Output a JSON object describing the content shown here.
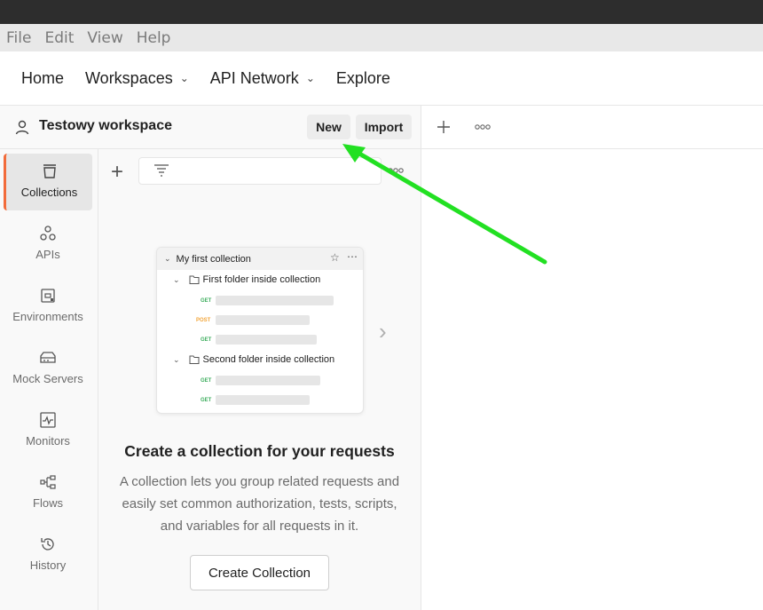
{
  "menu": [
    "File",
    "Edit",
    "View",
    "Help"
  ],
  "topnav": {
    "home": "Home",
    "workspaces": "Workspaces",
    "api_network": "API Network",
    "explore": "Explore"
  },
  "workspace": {
    "name": "Testowy workspace",
    "new_label": "New",
    "import_label": "Import"
  },
  "sidebar": {
    "items": [
      {
        "label": "Collections",
        "icon": "collections-icon"
      },
      {
        "label": "APIs",
        "icon": "apis-icon"
      },
      {
        "label": "Environments",
        "icon": "environments-icon"
      },
      {
        "label": "Mock Servers",
        "icon": "mock-servers-icon"
      },
      {
        "label": "Monitors",
        "icon": "monitors-icon"
      },
      {
        "label": "Flows",
        "icon": "flows-icon"
      },
      {
        "label": "History",
        "icon": "history-icon"
      }
    ]
  },
  "preview": {
    "collection_title": "My first collection",
    "folder1": "First folder inside collection",
    "folder2": "Second folder inside collection",
    "get": "GET",
    "post": "POST"
  },
  "empty_state": {
    "headline": "Create a collection for your requests",
    "description": "A collection lets you group related requests and easily set common authorization, tests, scripts, and variables for all requests in it.",
    "button": "Create Collection"
  },
  "colors": {
    "accent": "#f26b3a",
    "arrow": "#22e022",
    "get": "#3fae5f",
    "post": "#f2a53a"
  }
}
